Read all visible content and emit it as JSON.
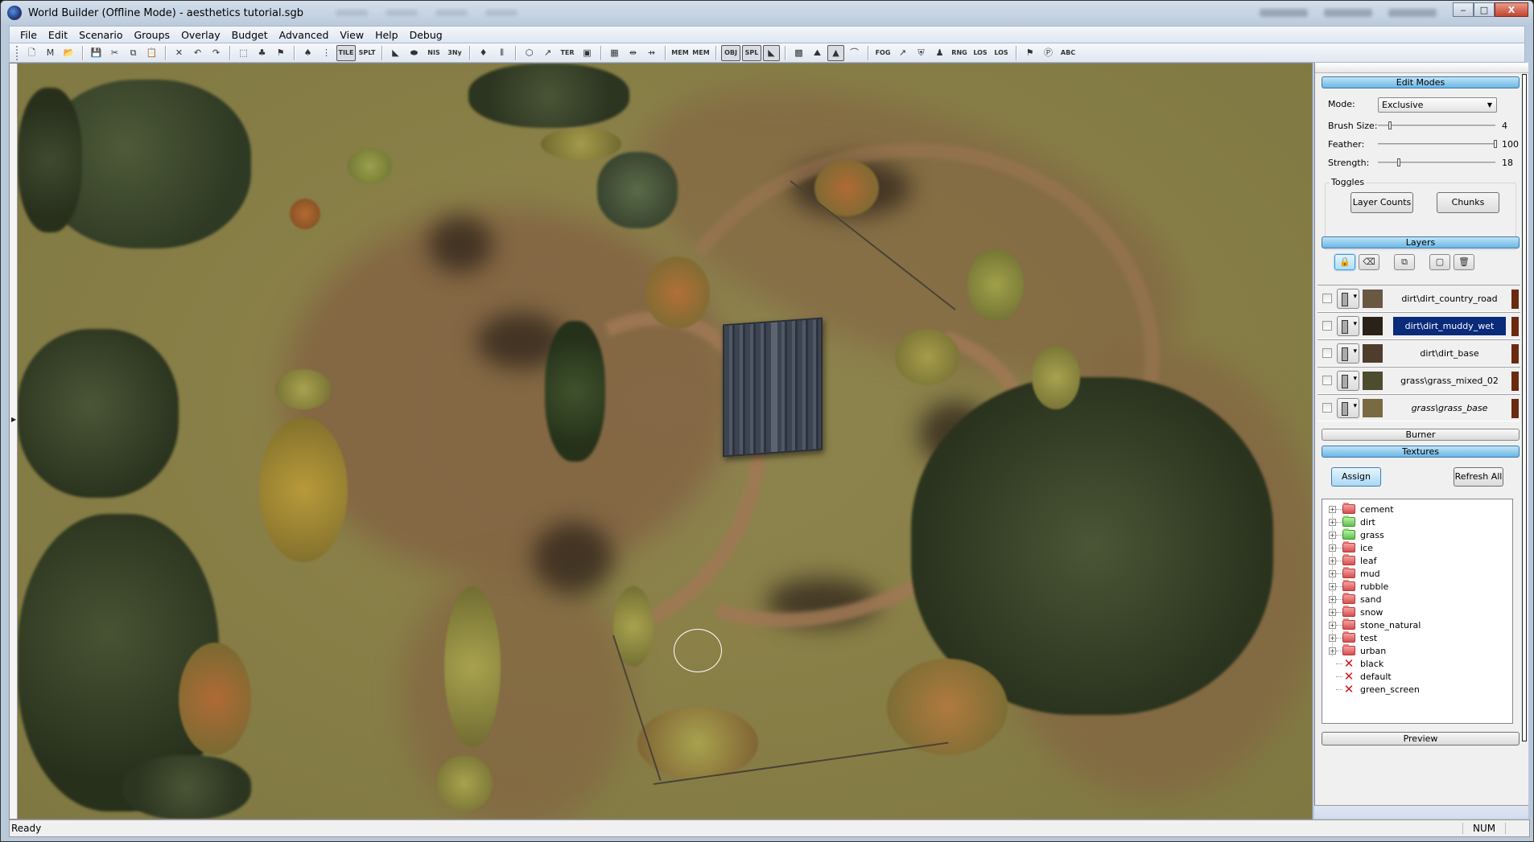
{
  "window": {
    "title": "World Builder (Offline Mode) - aesthetics tutorial.sgb",
    "controls": {
      "minimize": "‒",
      "maximize": "□",
      "close": "X"
    }
  },
  "menu": [
    "File",
    "Edit",
    "Scenario",
    "Groups",
    "Overlay",
    "Budget",
    "Advanced",
    "View",
    "Help",
    "Debug"
  ],
  "toolbar": {
    "buttons": [
      {
        "name": "new-icon",
        "glyph": "🗋"
      },
      {
        "name": "new-map-icon",
        "glyph": "M"
      },
      {
        "name": "open-folder-icon",
        "glyph": "📂"
      },
      {
        "sep": true
      },
      {
        "name": "save-icon",
        "glyph": "💾"
      },
      {
        "name": "cut-icon",
        "glyph": "✂"
      },
      {
        "name": "copy-icon",
        "glyph": "⧉"
      },
      {
        "name": "paste-icon",
        "glyph": "📋"
      },
      {
        "sep": true
      },
      {
        "name": "delete-icon",
        "glyph": "✕"
      },
      {
        "name": "undo-icon",
        "glyph": "↶"
      },
      {
        "name": "redo-icon",
        "glyph": "↷"
      },
      {
        "sep": true
      },
      {
        "name": "select-region-icon",
        "glyph": "⬚"
      },
      {
        "name": "squad-icon",
        "glyph": "♣"
      },
      {
        "name": "flag-icon",
        "glyph": "⚑"
      },
      {
        "sep": true
      },
      {
        "name": "tree-icon",
        "glyph": "♠"
      },
      {
        "name": "traffic-light-icon",
        "glyph": "⋮"
      },
      {
        "name": "tile-icon",
        "glyph": "TILE",
        "text": true,
        "pressed": true
      },
      {
        "name": "split-icon",
        "glyph": "SPLT",
        "text": true
      },
      {
        "sep": true
      },
      {
        "name": "road-icon",
        "glyph": "◣"
      },
      {
        "name": "water-icon",
        "glyph": "⬬"
      },
      {
        "name": "nis-icon",
        "glyph": "NIS",
        "text": true
      },
      {
        "name": "3ny-icon",
        "glyph": "3Ny",
        "text": true
      },
      {
        "sep": true
      },
      {
        "name": "marker-icon",
        "glyph": "♦"
      },
      {
        "name": "chart-icon",
        "glyph": "⫴"
      },
      {
        "sep": true
      },
      {
        "name": "gem-icon",
        "glyph": "⬡"
      },
      {
        "name": "arrow-icon",
        "glyph": "↗"
      },
      {
        "name": "ter-icon",
        "glyph": "TER",
        "text": true
      },
      {
        "name": "frame-icon",
        "glyph": "▣"
      },
      {
        "sep": true
      },
      {
        "name": "calendar-icon",
        "glyph": "▦"
      },
      {
        "name": "split-left-icon",
        "glyph": "⇹"
      },
      {
        "name": "split-right-icon",
        "glyph": "⇸"
      },
      {
        "sep": true
      },
      {
        "name": "mem-dmp-icon",
        "glyph": "MEM",
        "text": true
      },
      {
        "name": "mem-stat-icon",
        "glyph": "MEM",
        "text": true
      },
      {
        "sep": true
      },
      {
        "name": "show-obj-icon",
        "glyph": "OBJ",
        "text": true,
        "pressed": true
      },
      {
        "name": "show-spl-icon",
        "glyph": "SPL",
        "text": true,
        "pressed": true
      },
      {
        "name": "show-road-icon",
        "glyph": "◣",
        "pressed": true
      },
      {
        "sep": true
      },
      {
        "name": "show-checker-icon",
        "glyph": "▩"
      },
      {
        "name": "show-terrain-icon",
        "glyph": "⛰"
      },
      {
        "name": "show-mountain-icon",
        "glyph": "▲",
        "pressed": true
      },
      {
        "name": "show-bridge-icon",
        "glyph": "⌒"
      },
      {
        "sep": true
      },
      {
        "name": "show-fog-icon",
        "glyph": "FOG",
        "text": true
      },
      {
        "name": "show-arrow-icon",
        "glyph": "↗"
      },
      {
        "name": "show-shield-icon",
        "glyph": "⛨"
      },
      {
        "name": "show-units-icon",
        "glyph": "♟"
      },
      {
        "name": "show-rng-icon",
        "glyph": "RNG",
        "text": true
      },
      {
        "name": "show-los-icon",
        "glyph": "LOS",
        "text": true
      },
      {
        "name": "show-los2-icon",
        "glyph": "LOS",
        "text": true
      },
      {
        "sep": true
      },
      {
        "name": "show-flag-icon",
        "glyph": "⚑"
      },
      {
        "name": "show-flag-circle-icon",
        "glyph": "Ⓟ"
      },
      {
        "name": "show-flag-abc-icon",
        "glyph": "ABC",
        "text": true
      }
    ]
  },
  "panel": {
    "edit_modes": {
      "header": "Edit Modes",
      "mode_label": "Mode:",
      "mode_value": "Exclusive",
      "brush_size_label": "Brush Size:",
      "brush_size_value": "4",
      "brush_size_fraction": 0.1,
      "feather_label": "Feather:",
      "feather_value": "100",
      "feather_fraction": 1.0,
      "strength_label": "Strength:",
      "strength_value": "18",
      "strength_fraction": 0.18,
      "toggles_label": "Toggles",
      "layer_counts_button": "Layer Counts",
      "chunks_button": "Chunks"
    },
    "layers": {
      "header": "Layers",
      "tools": [
        {
          "name": "lock-icon",
          "glyph": "🔒",
          "active": true
        },
        {
          "name": "eraser-icon",
          "glyph": "⌫"
        },
        {
          "name": "replace-icon",
          "glyph": "⧉"
        },
        {
          "name": "new-layer-icon",
          "glyph": "▢"
        },
        {
          "name": "trash-icon",
          "glyph": "🗑"
        }
      ],
      "items": [
        {
          "name": "dirt\\dirt_country_road",
          "swatch": "#6a5843",
          "selected": false,
          "italic": false
        },
        {
          "name": "dirt\\dirt_muddy_wet",
          "swatch": "#2a2118",
          "selected": true,
          "italic": false
        },
        {
          "name": "dirt\\dirt_base",
          "swatch": "#4e3d2c",
          "selected": false,
          "italic": false
        },
        {
          "name": "grass\\grass_mixed_02",
          "swatch": "#4e4c2e",
          "selected": false,
          "italic": false
        },
        {
          "name": "grass\\grass_base",
          "swatch": "#7a6a42",
          "selected": false,
          "italic": true
        }
      ]
    },
    "burner": {
      "header": "Burner"
    },
    "textures": {
      "header": "Textures",
      "assign_button": "Assign",
      "refresh_button": "Refresh All",
      "folders": [
        {
          "label": "cement",
          "color": "red"
        },
        {
          "label": "dirt",
          "color": "green"
        },
        {
          "label": "grass",
          "color": "green"
        },
        {
          "label": "ice",
          "color": "red"
        },
        {
          "label": "leaf",
          "color": "red"
        },
        {
          "label": "mud",
          "color": "red"
        },
        {
          "label": "rubble",
          "color": "red"
        },
        {
          "label": "sand",
          "color": "red"
        },
        {
          "label": "snow",
          "color": "red"
        },
        {
          "label": "stone_natural",
          "color": "red"
        },
        {
          "label": "test",
          "color": "red"
        },
        {
          "label": "urban",
          "color": "red"
        }
      ],
      "items": [
        "black",
        "default",
        "green_screen"
      ]
    },
    "preview_button": "Preview"
  },
  "status": {
    "text": "Ready",
    "num": "NUM"
  },
  "colors": {
    "selected_layer_bg": "#0a2a7a",
    "section_header_blue": "#6ab7e6",
    "layer_color_bar": "#6b2a10"
  }
}
